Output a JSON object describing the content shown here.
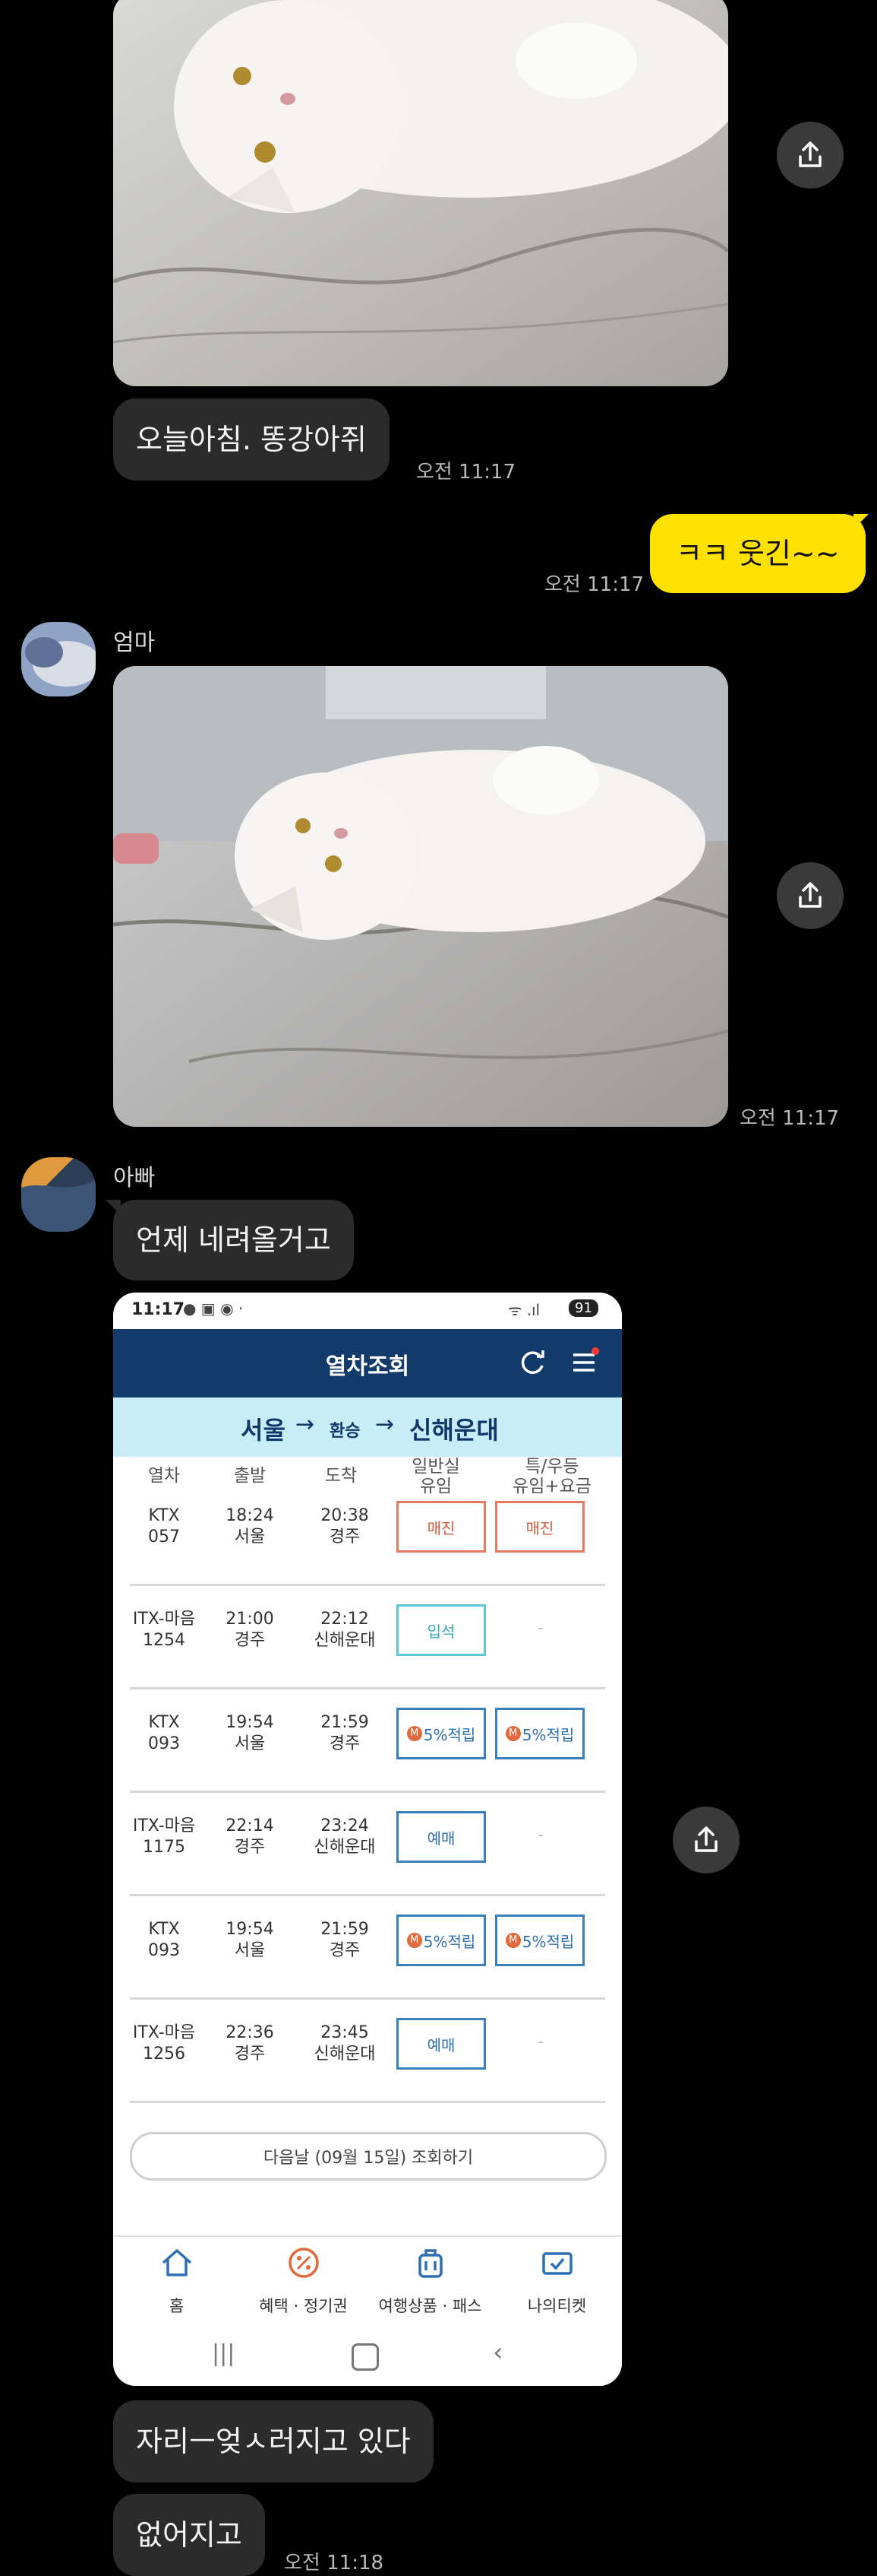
{
  "messages": {
    "m1_text": "오늘아침. 똥강아쥐",
    "m1_time": "오전 11:17",
    "m2_text": "ㅋㅋ 웃긴~~",
    "m2_time": "오전 11:17",
    "m3_sender": "엄마",
    "m3_time": "오전 11:17",
    "m4_sender": "아빠",
    "m4_text": "언제 네려올거고",
    "m5_text": "자리ㅡ엊ㅅ러지고 있다",
    "m6_text": "없어지고",
    "m6_time": "오전 11:18"
  },
  "colors": {
    "background": "#000000",
    "incoming_bubble": "#2b2b2b",
    "outgoing_bubble": "#ffe100",
    "header_blue": "#123a6b",
    "route_bar": "#c9edf6"
  },
  "icons": {
    "share": "share-icon",
    "refresh": "refresh-icon",
    "menu": "menu-icon",
    "home": "home-icon",
    "benefit": "percent-badge-icon",
    "travel": "luggage-icon",
    "ticket": "ticket-icon"
  },
  "screenshot": {
    "status_time": "11:17",
    "status_battery": "91",
    "title": "열차조회",
    "route_from": "서울",
    "route_transfer": "환승",
    "route_to": "신해운대",
    "headers": [
      "열차",
      "출발",
      "도착",
      "일반실\n유임",
      "특/우등\n유임+요금"
    ],
    "rows": [
      {
        "train": "KTX\n057",
        "dep_time": "18:24",
        "dep_st": "서울",
        "arr_time": "20:38",
        "arr_st": "경주",
        "general": "매진",
        "special": "매진"
      },
      {
        "train": "ITX-마음\n1254",
        "dep_time": "21:00",
        "dep_st": "경주",
        "arr_time": "22:12",
        "arr_st": "신해운대",
        "general": "입석",
        "special": "-"
      },
      {
        "train": "KTX\n093",
        "dep_time": "19:54",
        "dep_st": "서울",
        "arr_time": "21:59",
        "arr_st": "경주",
        "general": "5%적립",
        "special": "5%적립"
      },
      {
        "train": "ITX-마음\n1175",
        "dep_time": "22:14",
        "dep_st": "경주",
        "arr_time": "23:24",
        "arr_st": "신해운대",
        "general": "예매",
        "special": "-"
      },
      {
        "train": "KTX\n093",
        "dep_time": "19:54",
        "dep_st": "서울",
        "arr_time": "21:59",
        "arr_st": "경주",
        "general": "5%적립",
        "special": "5%적립"
      },
      {
        "train": "ITX-마음\n1256",
        "dep_time": "22:36",
        "dep_st": "경주",
        "arr_time": "23:45",
        "arr_st": "신해운대",
        "general": "예매",
        "special": "-"
      }
    ],
    "next_day_button": "다음날 (09월 15일) 조회하기",
    "nav": [
      "홈",
      "혜택 · 정기권",
      "여행상품 · 패스",
      "나의티켓"
    ]
  }
}
